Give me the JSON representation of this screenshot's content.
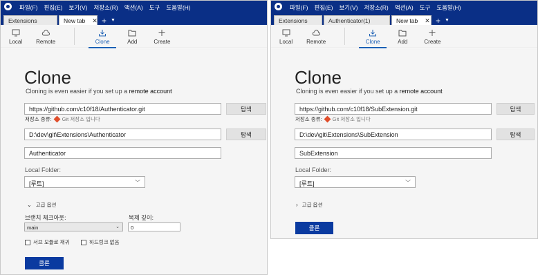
{
  "menu": [
    "파일(F)",
    "편집(E)",
    "보기(V)",
    "저장소(R)",
    "액션(A)",
    "도구",
    "도움말(H)"
  ],
  "colors": {
    "menubar": "#0a2f86",
    "primary_button": "#0a3aa0",
    "active_tool": "#1a5fb4",
    "git_icon": "#e04e2b"
  },
  "toolbar": {
    "local": "Local",
    "remote": "Remote",
    "clone": "Clone",
    "add": "Add",
    "create": "Create"
  },
  "left": {
    "tabs": [
      {
        "label": "Extensions"
      },
      {
        "label": "New tab",
        "active": true
      }
    ],
    "heading": "Clone",
    "subheading_prefix": "Cloning is even easier if you set up a ",
    "subheading_link": "remote account",
    "source_url": "https://github.com/c10f18/Authenticator.git",
    "browse": "탐색",
    "repo_type_label": "저장소 종류:",
    "repo_type_value": "Git 저장소 입니다",
    "dest_path": "D:\\dev\\git\\Extensions\\Authenticator",
    "browse2": "탐색",
    "name": "Authenticator",
    "local_folder_label": "Local Folder:",
    "local_folder_value": "[루트]",
    "advanced_label": "고급 옵션",
    "branch_label": "브랜치 체크아웃:",
    "branch_value": "main",
    "depth_label": "복제 깊이:",
    "depth_value": "0",
    "submodules_label": "서브 모듈로 재귀",
    "nohardlinks_label": "하드링크 없음",
    "clone_button": "클론"
  },
  "right": {
    "tabs": [
      {
        "label": "Extensions"
      },
      {
        "label": "Authenticator(1)"
      },
      {
        "label": "New tab",
        "active": true
      }
    ],
    "heading": "Clone",
    "subheading_prefix": "Cloning is even easier if you set up a ",
    "subheading_link": "remote account",
    "source_url": "https://github.com/c10f18/SubExtension.git",
    "browse": "탐색",
    "repo_type_label": "저장소 종류:",
    "repo_type_value": "Git 저장소 입니다",
    "dest_path": "D:\\dev\\git\\Extensions\\SubExtension",
    "browse2": "탐색",
    "name": "SubExtension",
    "local_folder_label": "Local Folder:",
    "local_folder_value": "[루트]",
    "advanced_label": "고급 옵션",
    "clone_button": "클론"
  }
}
